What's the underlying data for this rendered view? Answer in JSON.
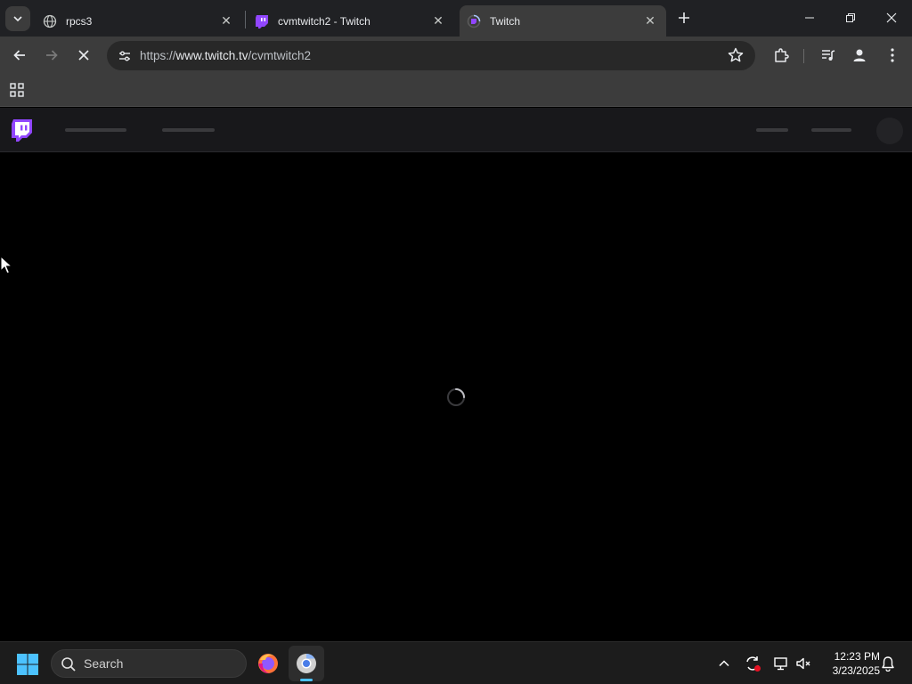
{
  "browser": {
    "tabs": [
      {
        "title": "rpcs3",
        "favicon": "globe-icon",
        "active": false
      },
      {
        "title": "cvmtwitch2 - Twitch",
        "favicon": "twitch-icon",
        "active": false
      },
      {
        "title": "Twitch",
        "favicon": "twitch-loading-icon",
        "active": true
      }
    ],
    "address": {
      "scheme": "https://",
      "host": "www.twitch.tv",
      "path": "/cvmtwitch2"
    }
  },
  "taskbar": {
    "search_label": "Search",
    "clock": {
      "time": "12:23 PM",
      "date": "3/23/2025"
    }
  },
  "colors": {
    "twitch_purple": "#9146ff",
    "accent_blue": "#4cc2ff"
  }
}
